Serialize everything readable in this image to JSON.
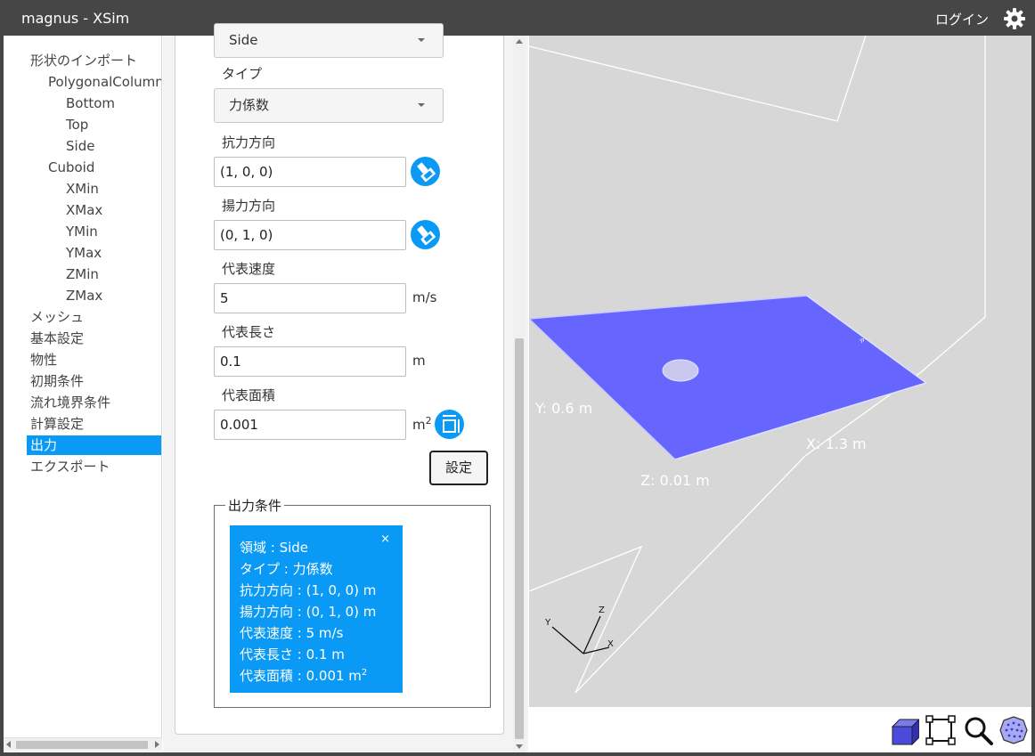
{
  "titlebar": {
    "title": "magnus - XSim",
    "login": "ログイン"
  },
  "tree": {
    "items": [
      {
        "label": "形状のインポート",
        "level": 0
      },
      {
        "label": "PolygonalColumn",
        "level": 1
      },
      {
        "label": "Bottom",
        "level": 2
      },
      {
        "label": "Top",
        "level": 2
      },
      {
        "label": "Side",
        "level": 2
      },
      {
        "label": "Cuboid",
        "level": 1
      },
      {
        "label": "XMin",
        "level": 2
      },
      {
        "label": "XMax",
        "level": 2
      },
      {
        "label": "YMin",
        "level": 2
      },
      {
        "label": "YMax",
        "level": 2
      },
      {
        "label": "ZMin",
        "level": 2
      },
      {
        "label": "ZMax",
        "level": 2
      },
      {
        "label": "メッシュ",
        "level": 0
      },
      {
        "label": "基本設定",
        "level": 0
      },
      {
        "label": "物性",
        "level": 0
      },
      {
        "label": "初期条件",
        "level": 0
      },
      {
        "label": "流れ境界条件",
        "level": 0
      },
      {
        "label": "計算設定",
        "level": 0
      },
      {
        "label": "出力",
        "level": 0,
        "selected": true
      },
      {
        "label": "エクスポート",
        "level": 0
      }
    ]
  },
  "form": {
    "region_select": "Side",
    "type_label": "タイプ",
    "type_select": "力係数",
    "drag_label": "抗力方向",
    "drag_value": "(1, 0, 0)",
    "lift_label": "揚力方向",
    "lift_value": "(0, 1, 0)",
    "velocity_label": "代表速度",
    "velocity_value": "5",
    "velocity_unit": "m/s",
    "length_label": "代表長さ",
    "length_value": "0.1",
    "length_unit": "m",
    "area_label": "代表面積",
    "area_value": "0.001",
    "area_unit": "m",
    "area_unit_sup": "2",
    "set_button": "設定"
  },
  "output_conditions": {
    "legend": "出力条件",
    "close": "×",
    "lines": [
      "領域 : Side",
      "タイプ : 力係数",
      "抗力方向 : (1, 0, 0) m",
      "揚力方向 : (0, 1, 0) m",
      "代表速度 : 5 m/s",
      "代表長さ : 0.1 m",
      "代表面積 : 0.001 m"
    ],
    "last_sup": "2"
  },
  "viewport": {
    "dim_x": "X: 1.3 m",
    "dim_y": "Y: 0.6 m",
    "dim_z": "Z: 0.01 m",
    "axis_x": "X",
    "axis_y": "Y",
    "axis_z": "Z",
    "plane_color": "#6666ff",
    "background": "#d7d7d7"
  },
  "toolbar": {
    "icons": [
      "cube-icon",
      "fit-frame-icon",
      "zoom-icon",
      "sphere-icon"
    ]
  },
  "colors": {
    "accent": "#0a9af5",
    "titlebar": "#464646"
  }
}
